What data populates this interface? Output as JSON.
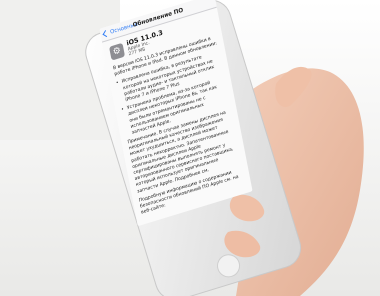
{
  "screen": {
    "back_label": "Основные",
    "title": "Обновление ПО",
    "update": {
      "name": "iOS 11.0.3",
      "vendor": "Apple Inc.",
      "size": "277 МБ"
    },
    "description": {
      "intro": "В версии iOS 11.0.3 исправлены ошибки в работе iPhone и iPad. В данном обновлении:",
      "bullets": [
        "Исправлена ошибка, в результате которой на некоторых устройствах не работали аудио- и тактильный отклик iPhone 7 и iPhone 7 Plus",
        "Устранена проблема, из-за которой дисплеи некоторых iPhone 6s, так как они были отремонтированы не с использованием оригинальных запчастей Apple."
      ],
      "note": "Примечание. В случае замены дисплея на неоригинальный качество изображения может ухудшиться, а дисплей может работать некорректно. Запатентованные оригинальные дисплеи Apple сертифицированы выполнять ремонт у авторизованного сервисного поставщика, который использует оригинальные запчасти Apple. Подробнее см.",
      "more": "Подробную информацию о содержании безопасности обновлений ПО Apple см. на веб-сайте:"
    }
  }
}
